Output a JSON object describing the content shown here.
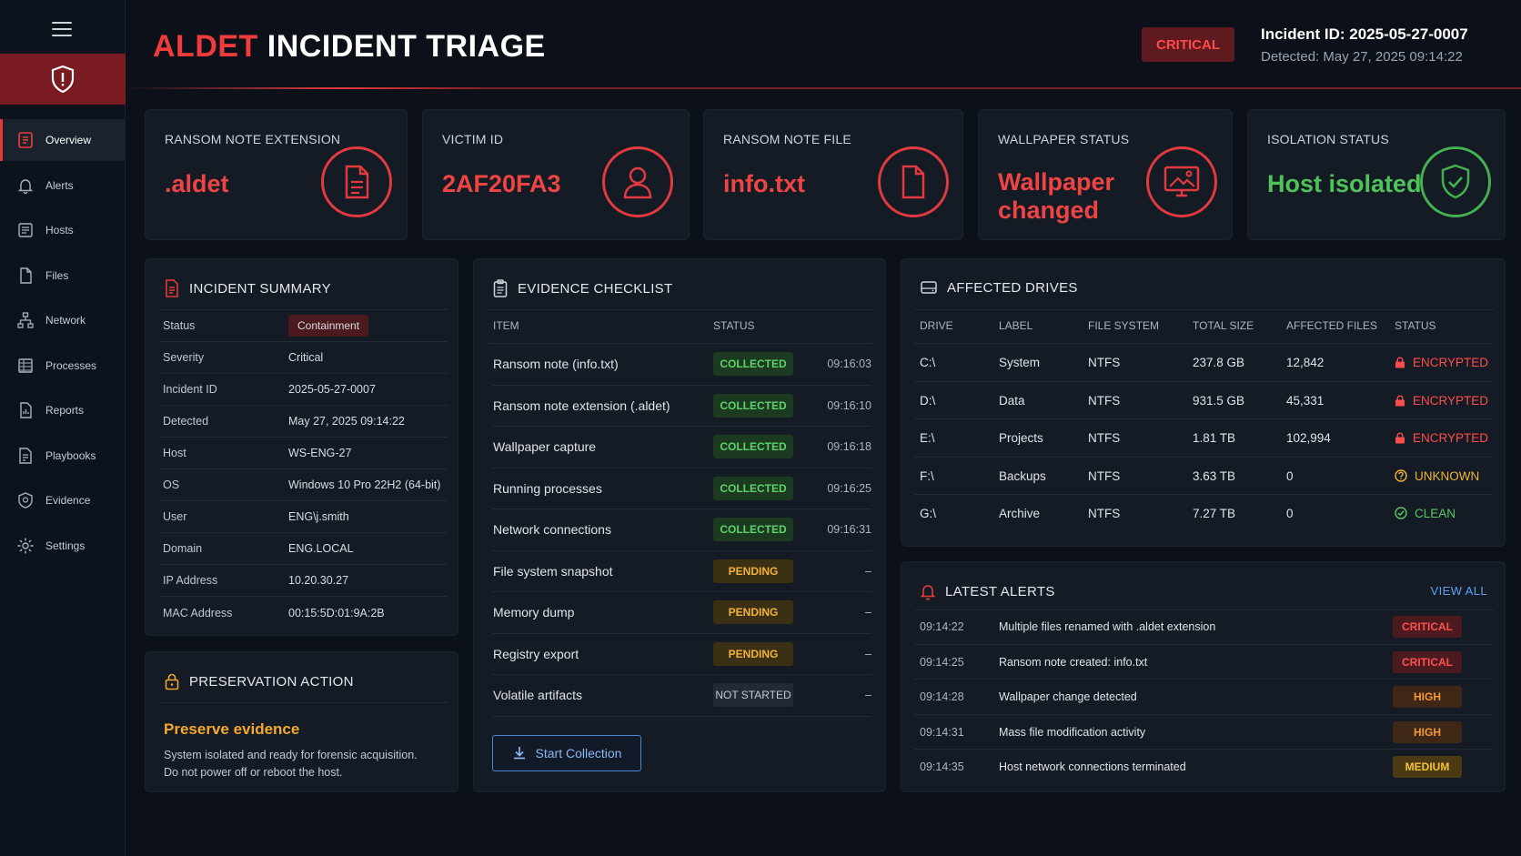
{
  "app": {
    "title_accent": "ALDET",
    "title_rest": "INCIDENT TRIAGE",
    "severity_badge": "CRITICAL",
    "incident_id_line": "Incident ID: 2025-05-27-0007",
    "detected_line": "Detected: May 27, 2025 09:14:22"
  },
  "sidebar": {
    "items": [
      {
        "label": "Overview",
        "icon": "overview-icon"
      },
      {
        "label": "Alerts",
        "icon": "bell-icon"
      },
      {
        "label": "Hosts",
        "icon": "host-icon"
      },
      {
        "label": "Files",
        "icon": "file-icon"
      },
      {
        "label": "Network",
        "icon": "network-icon"
      },
      {
        "label": "Processes",
        "icon": "processes-icon"
      },
      {
        "label": "Reports",
        "icon": "reports-icon"
      },
      {
        "label": "Playbooks",
        "icon": "playbooks-icon"
      },
      {
        "label": "Evidence",
        "icon": "evidence-icon"
      },
      {
        "label": "Settings",
        "icon": "gear-icon"
      }
    ]
  },
  "kpis": [
    {
      "label": "RANSOM NOTE EXTENSION",
      "value": ".aldet",
      "icon": "document-icon"
    },
    {
      "label": "VICTIM ID",
      "value": "2AF20FA3",
      "icon": "user-icon"
    },
    {
      "label": "RANSOM NOTE FILE",
      "value": "info.txt",
      "icon": "file-icon"
    },
    {
      "label": "WALLPAPER STATUS",
      "value_line1": "Wallpaper",
      "value_line2": "changed",
      "icon": "image-icon"
    },
    {
      "label": "ISOLATION STATUS",
      "value": "Host isolated",
      "icon": "shield-check-icon"
    }
  ],
  "summary": {
    "title": "INCIDENT SUMMARY",
    "rows": [
      {
        "k": "Status",
        "v": "Containment"
      },
      {
        "k": "Severity",
        "v": "Critical"
      },
      {
        "k": "Incident ID",
        "v": "2025-05-27-0007"
      },
      {
        "k": "Detected",
        "v": "May 27, 2025 09:14:22"
      },
      {
        "k": "Host",
        "v": "WS-ENG-27"
      },
      {
        "k": "OS",
        "v": "Windows 10 Pro 22H2 (64-bit)"
      },
      {
        "k": "User",
        "v": "ENG\\j.smith"
      },
      {
        "k": "Domain",
        "v": "ENG.LOCAL"
      },
      {
        "k": "IP Address",
        "v": "10.20.30.27"
      },
      {
        "k": "MAC Address",
        "v": "00:15:5D:01:9A:2B"
      }
    ]
  },
  "preservation": {
    "title": "PRESERVATION ACTION",
    "heading": "Preserve evidence",
    "line1": "System isolated and ready for forensic acquisition.",
    "line2": "Do not power off or reboot the host."
  },
  "evidence": {
    "title": "EVIDENCE CHECKLIST",
    "col_item": "ITEM",
    "col_status": "STATUS",
    "rows": [
      {
        "item": "Ransom note (info.txt)",
        "status": "COLLECTED",
        "time": "09:16:03"
      },
      {
        "item": "Ransom note extension (.aldet)",
        "status": "COLLECTED",
        "time": "09:16:10"
      },
      {
        "item": "Wallpaper capture",
        "status": "COLLECTED",
        "time": "09:16:18"
      },
      {
        "item": "Running processes",
        "status": "COLLECTED",
        "time": "09:16:25"
      },
      {
        "item": "Network connections",
        "status": "COLLECTED",
        "time": "09:16:31"
      },
      {
        "item": "File system snapshot",
        "status": "PENDING",
        "time": "–"
      },
      {
        "item": "Memory dump",
        "status": "PENDING",
        "time": "–"
      },
      {
        "item": "Registry export",
        "status": "PENDING",
        "time": "–"
      },
      {
        "item": "Volatile artifacts",
        "status": "NOT STARTED",
        "time": "–"
      }
    ],
    "button": "Start Collection"
  },
  "drives": {
    "title": "AFFECTED DRIVES",
    "columns": [
      "DRIVE",
      "LABEL",
      "FILE SYSTEM",
      "TOTAL SIZE",
      "AFFECTED FILES",
      "STATUS"
    ],
    "rows": [
      {
        "drive": "C:\\",
        "label": "System",
        "fs": "NTFS",
        "size": "237.8 GB",
        "files": "12,842",
        "status": "ENCRYPTED"
      },
      {
        "drive": "D:\\",
        "label": "Data",
        "fs": "NTFS",
        "size": "931.5 GB",
        "files": "45,331",
        "status": "ENCRYPTED"
      },
      {
        "drive": "E:\\",
        "label": "Projects",
        "fs": "NTFS",
        "size": "1.81 TB",
        "files": "102,994",
        "status": "ENCRYPTED"
      },
      {
        "drive": "F:\\",
        "label": "Backups",
        "fs": "NTFS",
        "size": "3.63 TB",
        "files": "0",
        "status": "UNKNOWN"
      },
      {
        "drive": "G:\\",
        "label": "Archive",
        "fs": "NTFS",
        "size": "7.27 TB",
        "files": "0",
        "status": "CLEAN"
      }
    ]
  },
  "alerts": {
    "title": "LATEST ALERTS",
    "view_all": "VIEW ALL",
    "rows": [
      {
        "time": "09:14:22",
        "text": "Multiple files renamed with .aldet extension",
        "sev": "CRITICAL"
      },
      {
        "time": "09:14:25",
        "text": "Ransom note created: info.txt",
        "sev": "CRITICAL"
      },
      {
        "time": "09:14:28",
        "text": "Wallpaper change detected",
        "sev": "HIGH"
      },
      {
        "time": "09:14:31",
        "text": "Mass file modification activity",
        "sev": "HIGH"
      },
      {
        "time": "09:14:35",
        "text": "Host network connections terminated",
        "sev": "MEDIUM"
      }
    ]
  },
  "colors": {
    "accent_red": "#ef3b3b",
    "success_green": "#4fc25a",
    "warning_amber": "#f2b33a",
    "link_blue": "#5fa0f5",
    "background": "#0c1119",
    "panel": "#141b25"
  }
}
